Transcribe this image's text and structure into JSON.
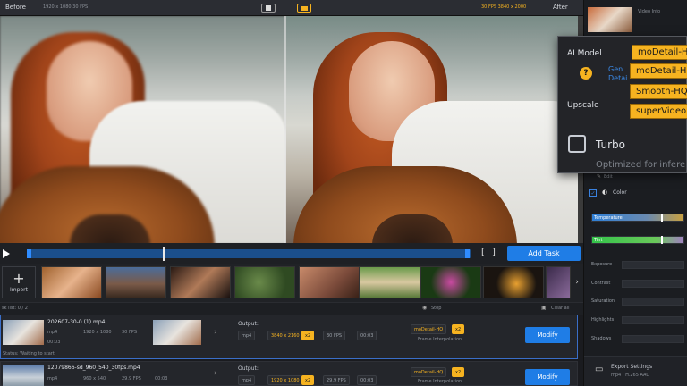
{
  "header": {
    "before_label": "Before",
    "before_info": "1920 x 1080 30 FPS",
    "after_label": "After",
    "after_info": "30 FPS 3840 x 2000"
  },
  "sidebar": {
    "video_info_label": "Video Info",
    "edit_label": "Edit",
    "color_label": "Color",
    "sliders": [
      {
        "label": "Temperature",
        "value": 0.75,
        "color": "#2f7fd6"
      },
      {
        "label": "Tint",
        "value": 0.75,
        "color": "#34c44a"
      },
      {
        "label": "Exposure",
        "value": 0.5
      },
      {
        "label": "Contrast",
        "value": 0.5
      },
      {
        "label": "Saturation",
        "value": 0.5
      },
      {
        "label": "Highlights",
        "value": 0.5
      },
      {
        "label": "Shadows",
        "value": 0.5
      }
    ],
    "export_title": "Export Settings",
    "export_sub": "mp4 | H.265 AAC"
  },
  "popup": {
    "ai_model_label": "AI Model",
    "gen_label": "Gen",
    "detail_label": "Detai",
    "upscale_label": "Upscale",
    "options": [
      "moDetail-HQ",
      "moDetail-HQ",
      "Smooth-HQ",
      "superVideo"
    ],
    "turbo_label": "Turbo",
    "turbo_sub": "Optimized for infere"
  },
  "timeline": {
    "add_task_label": "Add Task",
    "bracket_left": "[",
    "bracket_right": "]"
  },
  "thumbs": {
    "import_label": "Import",
    "import_plus": "+"
  },
  "taskbar": {
    "count_label": "sk list: 0 / 2",
    "stop_label": "Stop",
    "clear_label": "Clear all"
  },
  "tasks": [
    {
      "filename": "202607-30-0 (1).mp4",
      "format": "mp4",
      "res": "1920 x 1080",
      "fps": "30 FPS",
      "duration": "00:03",
      "output_label": "Output:",
      "out_format": "mp4",
      "out_res": "3840 x 2160",
      "out_badge": "x2",
      "out_fps": "30 FPS",
      "out_duration": "00:03",
      "model": "moDetail-HQ",
      "model_badge": "x2",
      "model_sub": "Frame Interpolation",
      "status": "Status: Waiting to start",
      "modify_label": "Modify"
    },
    {
      "filename": "12079866-sd_960_540_30fps.mp4",
      "format": "mp4",
      "res": "960 x 540",
      "fps": "29.9 FPS",
      "duration": "00:03",
      "output_label": "Output:",
      "out_format": "mp4",
      "out_res": "1920 x 1080",
      "out_badge": "x2",
      "out_fps": "29.9 FPS",
      "out_duration": "00:03",
      "model": "moDetail-HQ",
      "model_badge": "x2",
      "model_sub": "Frame Interpolation",
      "status": "",
      "modify_label": "Modify"
    }
  ],
  "colors": {
    "accent": "#1f7de6",
    "yellow": "#f6b320",
    "panel": "#24262b"
  }
}
